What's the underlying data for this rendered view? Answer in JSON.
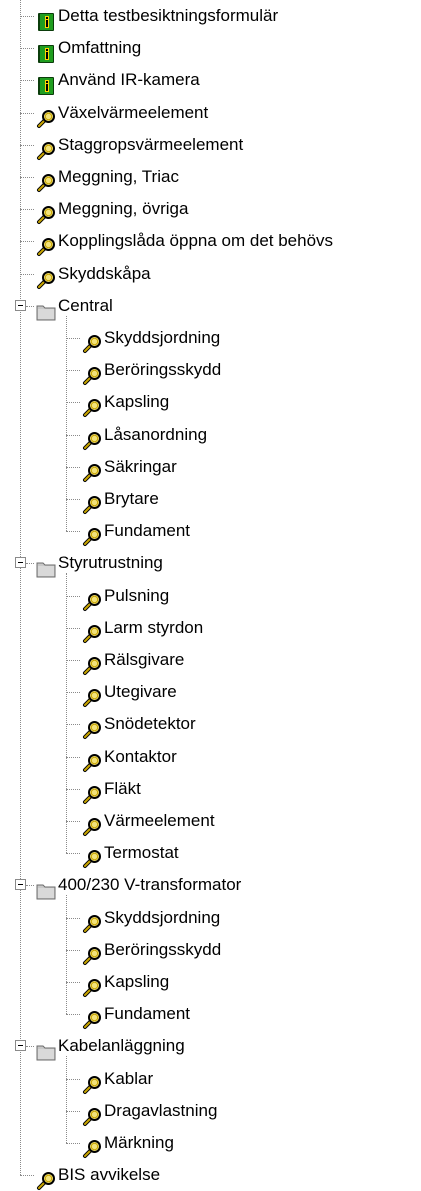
{
  "tree": {
    "items": [
      {
        "label": "Detta testbesiktningsformulär",
        "icon": "info-book-icon",
        "level": 1
      },
      {
        "label": "Omfattning",
        "icon": "info-book-icon",
        "level": 1
      },
      {
        "label": "Använd IR-kamera",
        "icon": "info-book-icon",
        "level": 1
      },
      {
        "label": "Växelvärmeelement",
        "icon": "magnifier-icon",
        "level": 1
      },
      {
        "label": "Staggropsvärmeelement",
        "icon": "magnifier-icon",
        "level": 1
      },
      {
        "label": "Meggning, Triac",
        "icon": "magnifier-icon",
        "level": 1
      },
      {
        "label": "Meggning, övriga",
        "icon": "magnifier-icon",
        "level": 1
      },
      {
        "label": "Kopplingslåda öppna om det behövs",
        "icon": "magnifier-icon",
        "level": 1
      },
      {
        "label": "Skyddskåpa",
        "icon": "magnifier-icon",
        "level": 1
      },
      {
        "label": "Central",
        "icon": "folder-icon",
        "level": 1,
        "expanded": true
      },
      {
        "label": "Skyddsjordning",
        "icon": "magnifier-icon",
        "level": 2
      },
      {
        "label": "Beröringsskydd",
        "icon": "magnifier-icon",
        "level": 2
      },
      {
        "label": "Kapsling",
        "icon": "magnifier-icon",
        "level": 2
      },
      {
        "label": "Låsanordning",
        "icon": "magnifier-icon",
        "level": 2
      },
      {
        "label": "Säkringar",
        "icon": "magnifier-icon",
        "level": 2
      },
      {
        "label": "Brytare",
        "icon": "magnifier-icon",
        "level": 2
      },
      {
        "label": "Fundament",
        "icon": "magnifier-icon",
        "level": 2
      },
      {
        "label": "Styrutrustning",
        "icon": "folder-icon",
        "level": 1,
        "expanded": true
      },
      {
        "label": "Pulsning",
        "icon": "magnifier-icon",
        "level": 2
      },
      {
        "label": "Larm styrdon",
        "icon": "magnifier-icon",
        "level": 2
      },
      {
        "label": "Rälsgivare",
        "icon": "magnifier-icon",
        "level": 2
      },
      {
        "label": "Utegivare",
        "icon": "magnifier-icon",
        "level": 2
      },
      {
        "label": "Snödetektor",
        "icon": "magnifier-icon",
        "level": 2
      },
      {
        "label": "Kontaktor",
        "icon": "magnifier-icon",
        "level": 2
      },
      {
        "label": "Fläkt",
        "icon": "magnifier-icon",
        "level": 2
      },
      {
        "label": "Värmeelement",
        "icon": "magnifier-icon",
        "level": 2
      },
      {
        "label": "Termostat",
        "icon": "magnifier-icon",
        "level": 2
      },
      {
        "label": "400/230 V-transformator",
        "icon": "folder-icon",
        "level": 1,
        "expanded": true
      },
      {
        "label": "Skyddsjordning",
        "icon": "magnifier-icon",
        "level": 2
      },
      {
        "label": "Beröringsskydd",
        "icon": "magnifier-icon",
        "level": 2
      },
      {
        "label": "Kapsling",
        "icon": "magnifier-icon",
        "level": 2
      },
      {
        "label": "Fundament",
        "icon": "magnifier-icon",
        "level": 2
      },
      {
        "label": "Kabelanläggning",
        "icon": "folder-icon",
        "level": 1,
        "expanded": true
      },
      {
        "label": "Kablar",
        "icon": "magnifier-icon",
        "level": 2
      },
      {
        "label": "Dragavlastning",
        "icon": "magnifier-icon",
        "level": 2
      },
      {
        "label": "Märkning",
        "icon": "magnifier-icon",
        "level": 2
      },
      {
        "label": "BIS avvikelse",
        "icon": "magnifier-icon",
        "level": 1
      }
    ]
  },
  "colors": {
    "book_green": "#1f9d1f",
    "book_dark": "#0b3d0b",
    "book_badge": "#ffd700",
    "magnifier_handle": "#c7a400",
    "magnifier_lens": "#f2e27a",
    "folder_fill": "#c8c8c8",
    "folder_edge": "#6b6b6b",
    "tree_line": "#8a8a8a"
  }
}
